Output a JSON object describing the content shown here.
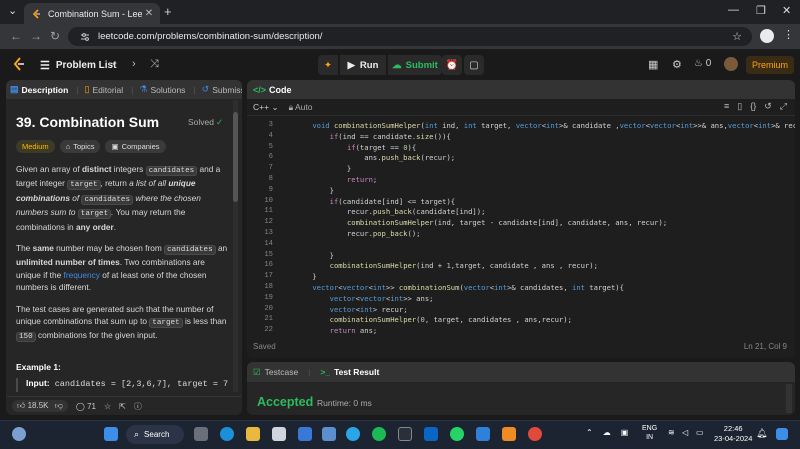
{
  "browser": {
    "tab_title": "Combination Sum - LeetCode",
    "url": "leetcode.com/problems/combination-sum/description/"
  },
  "header": {
    "problem_list": "Problem List",
    "run": "Run",
    "submit": "Submit",
    "streak_count": "0",
    "premium": "Premium"
  },
  "left_tabs": [
    "Description",
    "Editorial",
    "Solutions",
    "Submissions"
  ],
  "problem": {
    "title": "39. Combination Sum",
    "status": "Solved",
    "tags": [
      "Medium",
      "Topics",
      "Companies"
    ],
    "example_heading": "Example 1:",
    "example_input_label": "Input:",
    "example_input_value": " candidates = [2,3,6,7], target = 7"
  },
  "left_footer": {
    "likes": "18.5K",
    "comments": "71"
  },
  "code_panel": {
    "tab": "Code",
    "language": "C++",
    "auto": "Auto",
    "status": "Saved",
    "position": "Ln 21, Col 9",
    "lines": [
      {
        "n": "3",
        "t": "    void combinationSumHelper(int ind, int target, vector<int>& candidate ,vector<vector<int>>& ans,vector<int>& recur){"
      },
      {
        "n": "4",
        "t": "        if(ind == candidate.size()){"
      },
      {
        "n": "5",
        "t": "            if(target == 0){"
      },
      {
        "n": "6",
        "t": "                ans.push_back(recur);"
      },
      {
        "n": "7",
        "t": "            }"
      },
      {
        "n": "8",
        "t": "            return;"
      },
      {
        "n": "9",
        "t": "        }"
      },
      {
        "n": "10",
        "t": "        if(candidate[ind] <= target){"
      },
      {
        "n": "11",
        "t": "            recur.push_back(candidate[ind]);"
      },
      {
        "n": "12",
        "t": "            combinationSumHelper(ind, target - candidate[ind], candidate, ans, recur);"
      },
      {
        "n": "13",
        "t": "            recur.pop_back();"
      },
      {
        "n": "14",
        "t": ""
      },
      {
        "n": "15",
        "t": "        }"
      },
      {
        "n": "16",
        "t": "        combinationSumHelper(ind + 1,target, candidate , ans , recur);"
      },
      {
        "n": "17",
        "t": "    }"
      },
      {
        "n": "18",
        "t": "    vector<vector<int>> combinationSum(vector<int>& candidates, int target){"
      },
      {
        "n": "19",
        "t": "        vector<vector<int>> ans;"
      },
      {
        "n": "20",
        "t": "        vector<int> recur;"
      },
      {
        "n": "21",
        "t": "        combinationSumHelper(0, target, candidates , ans,recur);"
      },
      {
        "n": "22",
        "t": "        return ans;"
      }
    ]
  },
  "test_panel": {
    "tabs": [
      "Testcase",
      "Test Result"
    ],
    "result": "Accepted",
    "runtime": "Runtime: 0 ms"
  },
  "taskbar": {
    "search": "Search",
    "lang_top": "ENG",
    "lang_bottom": "IN",
    "time": "22:46",
    "date": "23-04-2024"
  },
  "colors": {
    "accepted": "#2cbb5d",
    "medium": "#ffb800",
    "premium": "#ffa116",
    "link": "#3e8ae6"
  }
}
